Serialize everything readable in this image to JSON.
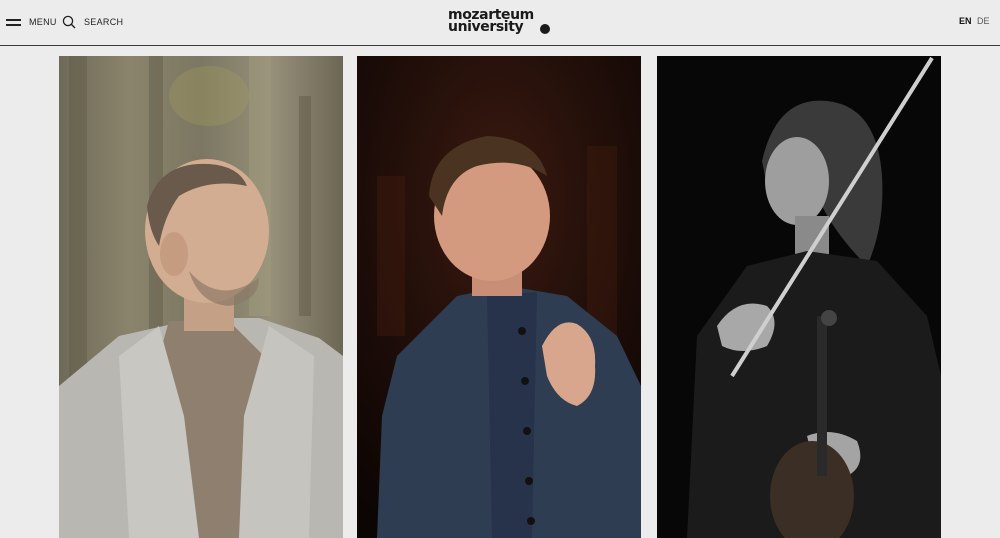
{
  "header": {
    "menu_label": "MENU",
    "search_label": "SEARCH",
    "logo_line1": "mozarteum",
    "logo_line2": "university",
    "languages": [
      {
        "code": "EN",
        "active": true
      },
      {
        "code": "DE",
        "active": false
      }
    ]
  },
  "colors": {
    "background": "#ececec",
    "text": "#1a1a1a",
    "divider": "#3a3a3a"
  },
  "cards": [
    {
      "subject": "portrait of a man in a light grey blazer in front of a stone wall",
      "photo_style": "color"
    },
    {
      "subject": "portrait of a conductor in a dark blue jacket gesturing",
      "photo_style": "color"
    },
    {
      "subject": "portrait of a woman with a violin",
      "photo_style": "black-and-white"
    }
  ]
}
